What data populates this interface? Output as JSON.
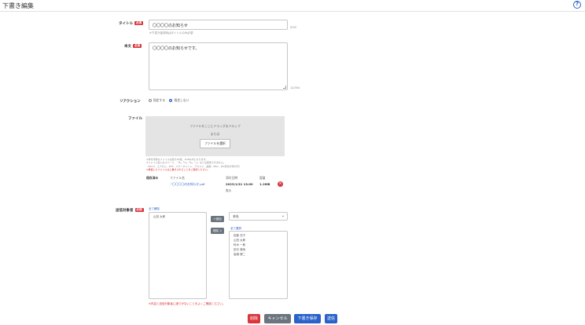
{
  "page": {
    "title": "下書き編集"
  },
  "title_field": {
    "label": "タイトル",
    "required": "必須",
    "value": "〇〇〇〇のお知らせ",
    "counter": "9/30",
    "hint": "※下書き保存時はタイトルのみ必須"
  },
  "body_field": {
    "label": "本文",
    "required": "必須",
    "value": "〇〇〇〇のお知らせです。",
    "counter": "12/300"
  },
  "reaction": {
    "label": "リアクション",
    "option_yes": "指定する",
    "option_no": "指定しない",
    "selected": "指定しない"
  },
  "file": {
    "label": "ファイル",
    "drop_text": "ファイルをここにドラッグ＆ドロップ",
    "or_text": "または",
    "select_button": "ファイルを選択",
    "notes": [
      "※添付可能なファイルは最大10個、1GB以内となります。",
      "※ファイル名にはスペース、「#」「%」「&」「+」などは使用できません。",
      "（Word、エクセル、PDF、パワーポイント、テキスト、画像、PNG、JPG形式が添付可）"
    ],
    "warning": "※重複したファイルは上書きされることをご確認ください。",
    "saved_label": "保存済み",
    "col_filename": "ファイル名",
    "col_attachment_date": "添付日時",
    "col_type": "容量",
    "saved_file": {
      "name": "〇〇〇〇のお知らせ.pdf",
      "date": "2023/1/31 13:00",
      "size": "1.2MB",
      "extra": "表示"
    }
  },
  "recipients": {
    "label": "送信対象者",
    "required": "必須",
    "select_all_left": "全て解除",
    "left_items": [
      "山田 太郎"
    ],
    "add_button": "+追加",
    "remove_button": "削除 ×",
    "dropdown_value": "本社",
    "select_all_right": "全て選択",
    "right_items": [
      "佐藤 花子",
      "山田 太郎",
      "鈴木 一郎",
      "田中 美咲",
      "高橋 健二"
    ],
    "warning": "※内容と送信対象者に誤りがないことをよくご確認ください。"
  },
  "actions": {
    "delete": "削除",
    "cancel": "キャンセル",
    "save_draft": "下書き保存",
    "send": "送信"
  },
  "colors": {
    "blue": "#2a62c9",
    "red": "#d9363e",
    "gray": "#6c757d"
  }
}
